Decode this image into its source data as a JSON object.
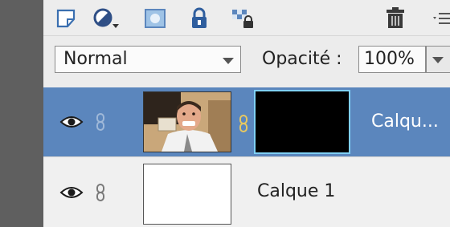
{
  "blend": {
    "mode": "Normal",
    "opacity_label": "Opacité :",
    "opacity_value": "100%"
  },
  "layers": [
    {
      "name": "Calqu...",
      "selected": true,
      "has_mask": true
    },
    {
      "name": "Calque 1",
      "selected": false,
      "has_mask": false
    }
  ],
  "icons": {
    "toolbar": [
      "new-layer-icon",
      "fill-adjustment-icon",
      "add-mask-icon",
      "lock-all-icon",
      "lock-transparency-icon",
      "trash-icon",
      "panel-menu-icon"
    ],
    "layer_row": [
      "eye-icon",
      "link-icon"
    ]
  },
  "colors": {
    "selected_row": "#5b86bd",
    "mask_border": "#7fd0f5",
    "left_strip": "#5f5f5f"
  }
}
